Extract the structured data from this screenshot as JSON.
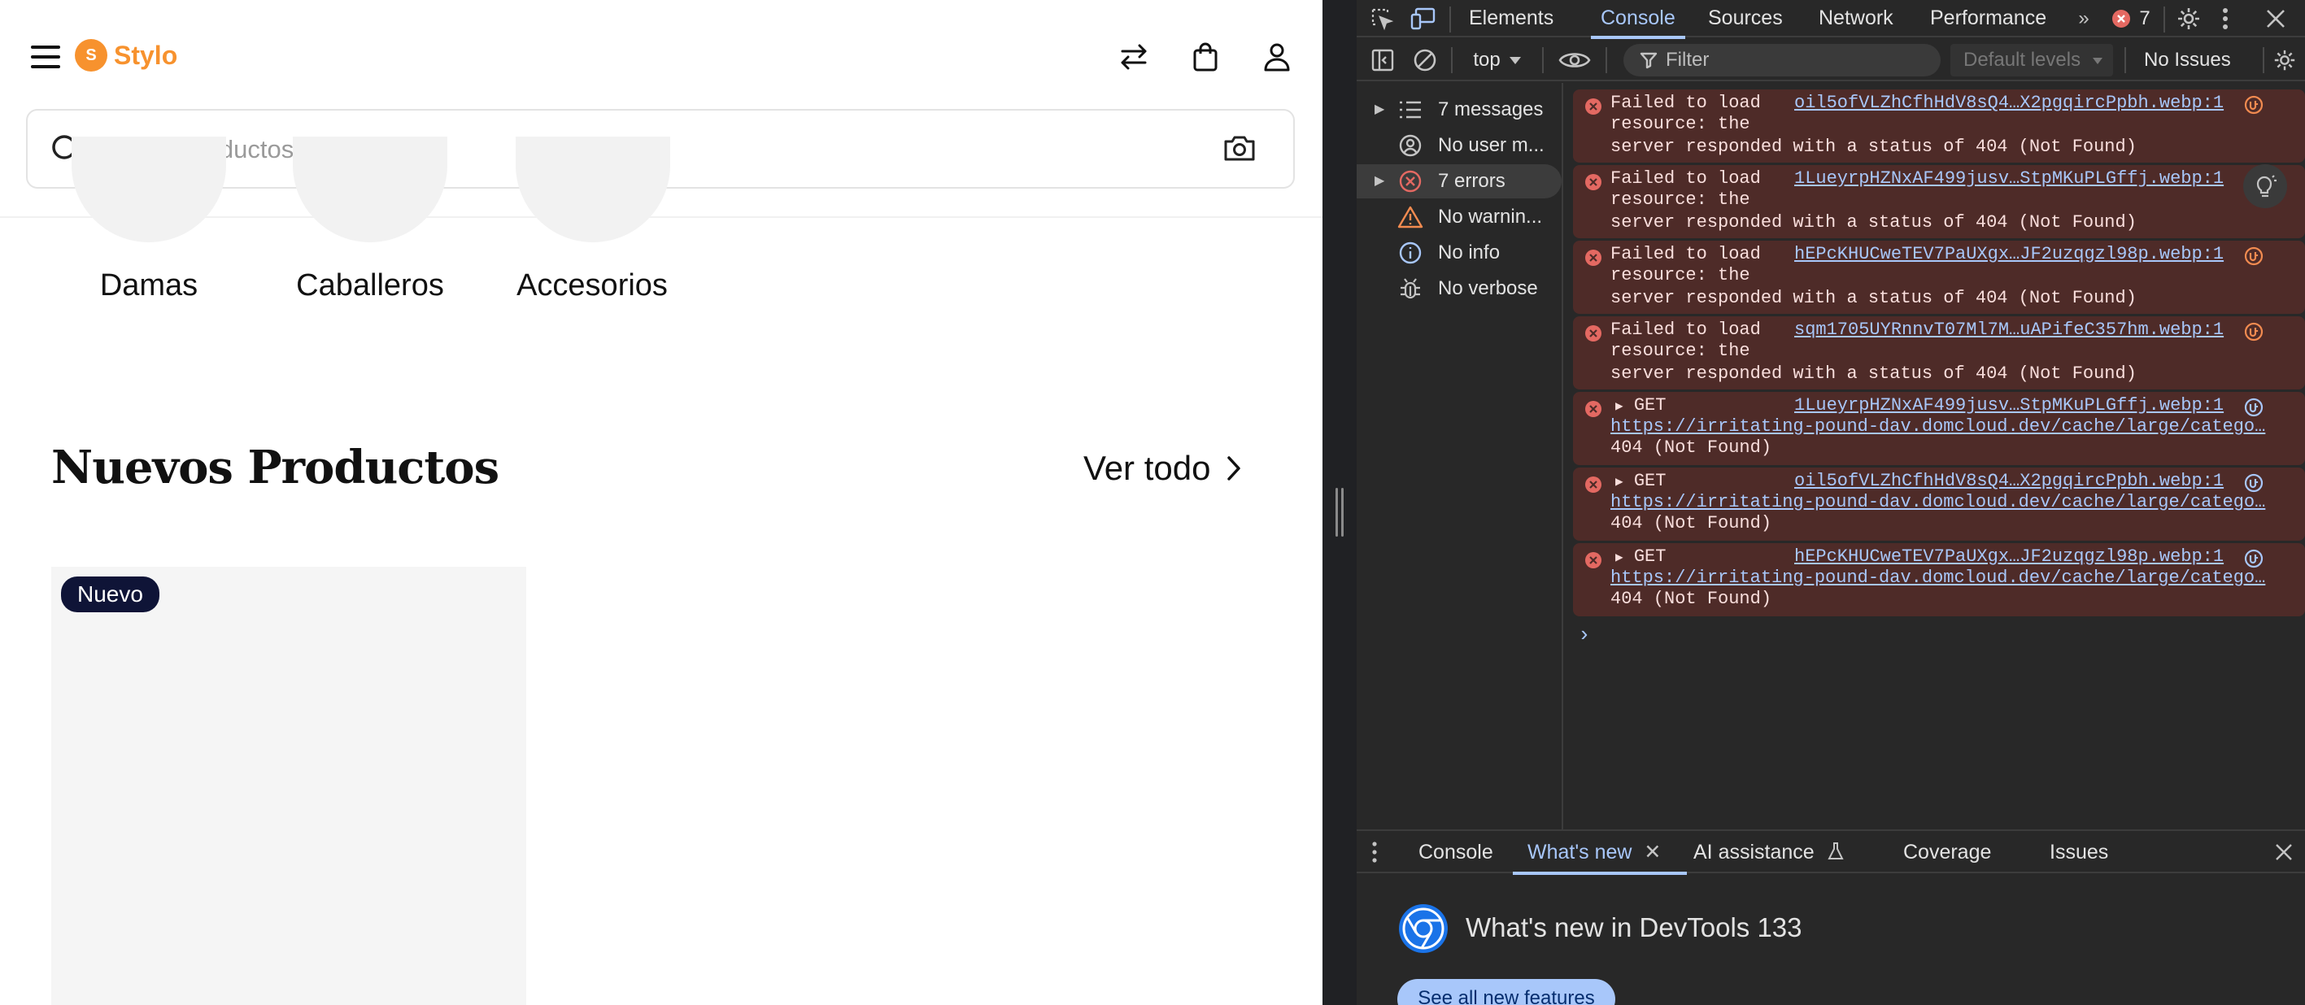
{
  "site": {
    "brand_letter": "S",
    "brand_name": "Stylo",
    "search_placeholder": "Buscar productos aquí",
    "categories": [
      "Damas",
      "Caballeros",
      "Accesorios"
    ],
    "section_title": "Nuevos Productos",
    "see_all": "Ver todo",
    "badge": "Nuevo",
    "brand_color": "#f7922e",
    "badge_color": "#0f1437"
  },
  "devtools": {
    "tabs": [
      "Elements",
      "Console",
      "Sources",
      "Network",
      "Performance"
    ],
    "active_tab": "Console",
    "error_count": "7",
    "context": "top",
    "filter_placeholder": "Filter",
    "levels": "Default levels",
    "issues": "No Issues",
    "sidebar": [
      {
        "label": "7 messages",
        "icon": "list-icon",
        "expandable": true
      },
      {
        "label": "No user m...",
        "icon": "user-icon",
        "expandable": false
      },
      {
        "label": "7 errors",
        "icon": "error-icon",
        "expandable": true
      },
      {
        "label": "No warnin...",
        "icon": "warning-icon",
        "expandable": false
      },
      {
        "label": "No info",
        "icon": "info-icon",
        "expandable": false
      },
      {
        "label": "No verbose",
        "icon": "bug-icon",
        "expandable": false
      }
    ],
    "messages": [
      {
        "type": "load",
        "l1": "Failed to load",
        "l2": "resource: the",
        "l3": "server responded with a status of 404 (Not Found)",
        "src": "oil5ofVLZhCfhHdV8sQ4…X2pgqircPpbh.webp:1"
      },
      {
        "type": "load",
        "l1": "Failed to load",
        "l2": "resource: the",
        "l3": "server responded with a status of 404 (Not Found)",
        "src": "1LueyrpHZNxAF499jusv…StpMKuPLGffj.webp:1"
      },
      {
        "type": "load",
        "l1": "Failed to load",
        "l2": "resource: the",
        "l3": "server responded with a status of 404 (Not Found)",
        "src": "hEPcKHUCweTEV7PaUXgx…JF2uzqgzl98p.webp:1"
      },
      {
        "type": "load",
        "l1": "Failed to load",
        "l2": "resource: the",
        "l3": "server responded with a status of 404 (Not Found)",
        "src": "sqm1705UYRnnvT07Ml7M…uAPifeC357hm.webp:1"
      },
      {
        "type": "get",
        "l1": "GET",
        "l2": "https://irritating-pound-dav.domcloud.dev/cache/large/catego…",
        "l3": "404 (Not Found)",
        "src": "1LueyrpHZNxAF499jusv…StpMKuPLGffj.webp:1"
      },
      {
        "type": "get",
        "l1": "GET",
        "l2": "https://irritating-pound-dav.domcloud.dev/cache/large/catego…",
        "l3": "404 (Not Found)",
        "src": "oil5ofVLZhCfhHdV8sQ4…X2pgqircPpbh.webp:1"
      },
      {
        "type": "get",
        "l1": "GET",
        "l2": "https://irritating-pound-dav.domcloud.dev/cache/large/catego…",
        "l3": "404 (Not Found)",
        "src": "hEPcKHUCweTEV7PaUXgx…JF2uzqgzl98p.webp:1"
      }
    ],
    "drawer_tabs": [
      "Console",
      "What's new",
      "AI assistance",
      "Coverage",
      "Issues"
    ],
    "active_drawer_tab": "What's new",
    "whatsnew_title": "What's new in DevTools 133",
    "whatsnew_button": "See all new features",
    "error_color": "#e46962",
    "link_color": "#a8c7fa"
  }
}
